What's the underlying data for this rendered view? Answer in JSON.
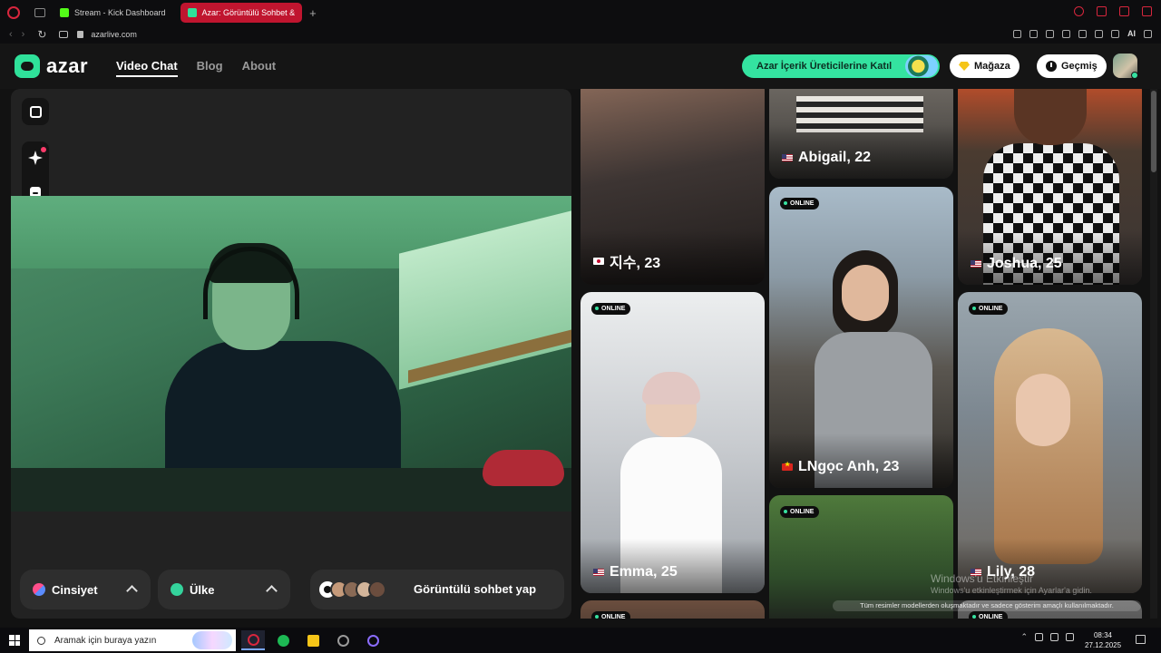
{
  "browser": {
    "tabs": [
      {
        "label": "Stream - Kick Dashboard",
        "active": false,
        "favicon_color": "#53fc18"
      },
      {
        "label": "Azar: Görüntülü Sohbet &",
        "active": true,
        "favicon_color": "#2fe19a"
      }
    ],
    "url": "azarlive.com",
    "toolbar_ai_label": "AI"
  },
  "header": {
    "logo_text": "azar",
    "nav": [
      {
        "label": "Video Chat",
        "active": true
      },
      {
        "label": "Blog",
        "active": false
      },
      {
        "label": "About",
        "active": false
      }
    ],
    "creator_cta": "Azar İçerik Üreticilerine Katıl",
    "shop_label": "Mağaza",
    "history_label": "Geçmiş"
  },
  "video": {
    "icons": [
      "expand-icon",
      "sparkle-effects-icon",
      "face-filter-icon"
    ],
    "filters": {
      "gender_label": "Cinsiyet",
      "country_label": "Ülke"
    },
    "start_label": "Görüntülü sohbet yap"
  },
  "profiles": {
    "online_badge": "ONLINE",
    "cards": [
      {
        "name": "지수, 23",
        "flag": "kr",
        "online": false,
        "col": 0,
        "bg": [
          "#3d3533",
          "#7a5c4f"
        ]
      },
      {
        "name": "Emma, 25",
        "flag": "us",
        "online": true,
        "col": 0,
        "bg": [
          "#d9dbdd",
          "#a9aeb4"
        ]
      },
      {
        "name": "",
        "flag": "",
        "online": true,
        "col": 0,
        "bg": [
          "#3a2f2a",
          "#6b4e3e"
        ]
      },
      {
        "name": "Abigail, 22",
        "flag": "us",
        "online": false,
        "col": 1,
        "bg": [
          "#3c3a37",
          "#8c8781"
        ]
      },
      {
        "name": "LNgọc Anh, 23",
        "flag": "vn",
        "online": true,
        "col": 1,
        "bg": [
          "#8fa3b4",
          "#53524c"
        ]
      },
      {
        "name": "",
        "flag": "",
        "online": true,
        "col": 1,
        "bg": [
          "#2f4d2a",
          "#4f7a3c"
        ]
      },
      {
        "name": "Joshua, 25",
        "flag": "us",
        "online": false,
        "col": 2,
        "bg": [
          "#c04f2a",
          "#e9e6e0"
        ]
      },
      {
        "name": "Lily, 28",
        "flag": "us",
        "online": true,
        "col": 2,
        "bg": [
          "#7d8891",
          "#b98a5c"
        ]
      },
      {
        "name": "",
        "flag": "",
        "online": true,
        "col": 2,
        "bg": [
          "#444",
          "#666"
        ]
      }
    ]
  },
  "overlay": {
    "watermark_title": "Windows'u Etkinleştir",
    "watermark_sub": "Windows'u etkinleştirmek için Ayarlar'a gidin.",
    "disclaimer": "Tüm resimler modellerden oluşmaktadır ve sadece gösterim amaçlı kullanılmaktadır."
  },
  "taskbar": {
    "search_placeholder": "Aramak için buraya yazın",
    "time": "08:34",
    "date": "27.12.2025",
    "apps": [
      {
        "name": "opera-icon",
        "color": "#d7263d",
        "active": true
      },
      {
        "name": "spotify-icon",
        "color": "#1db954",
        "active": false
      },
      {
        "name": "zap-icon",
        "color": "#f5c518",
        "active": false
      },
      {
        "name": "obs-icon",
        "color": "#9a9a9a",
        "active": false
      },
      {
        "name": "assistant-icon",
        "color": "#8b6cff",
        "active": false
      }
    ]
  }
}
